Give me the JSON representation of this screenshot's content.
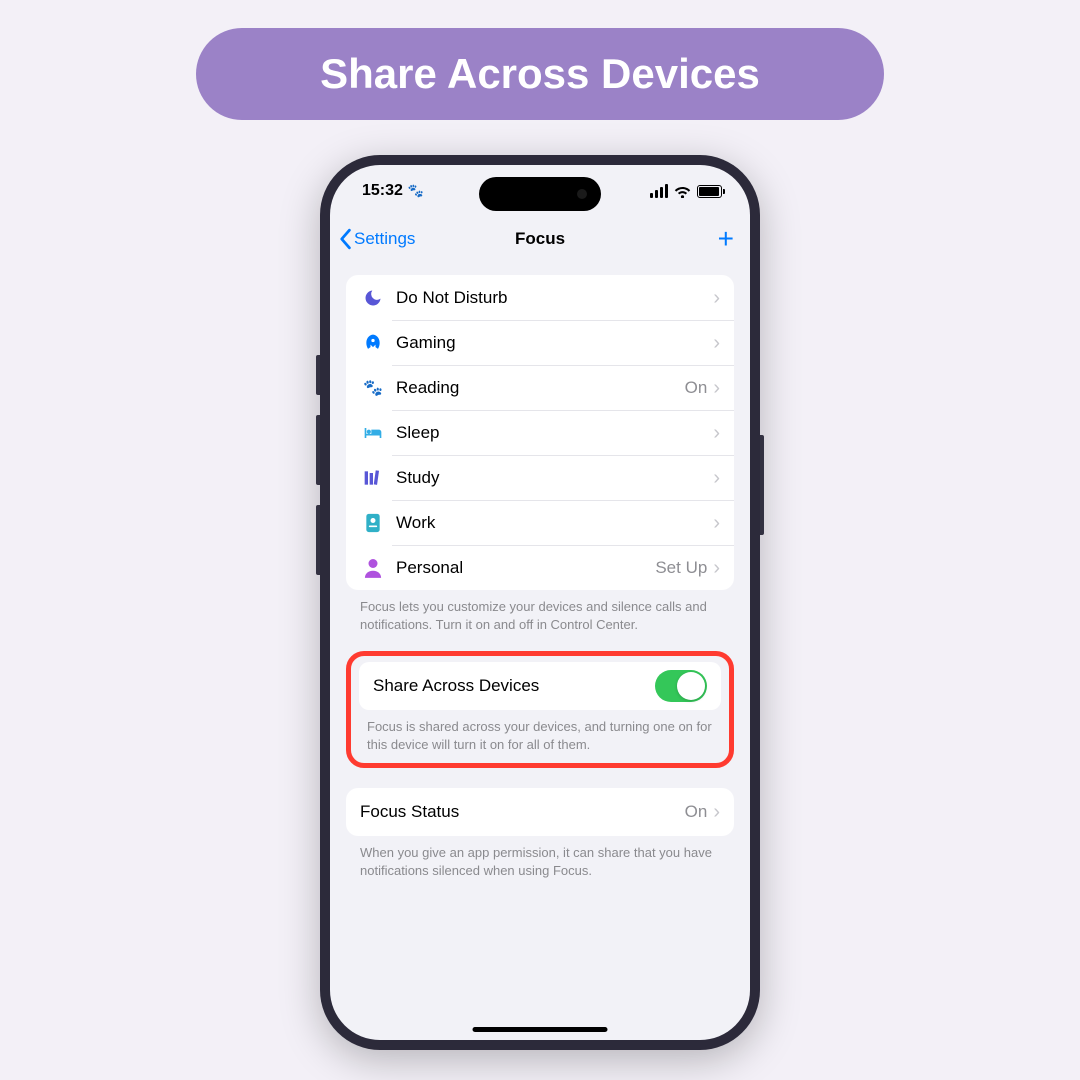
{
  "banner": {
    "title": "Share Across Devices"
  },
  "statusBar": {
    "time": "15:32",
    "paw": "🐾"
  },
  "nav": {
    "back": "Settings",
    "title": "Focus"
  },
  "focusList": [
    {
      "label": "Do Not Disturb",
      "value": ""
    },
    {
      "label": "Gaming",
      "value": ""
    },
    {
      "label": "Reading",
      "value": "On"
    },
    {
      "label": "Sleep",
      "value": ""
    },
    {
      "label": "Study",
      "value": ""
    },
    {
      "label": "Work",
      "value": ""
    },
    {
      "label": "Personal",
      "value": "Set Up"
    }
  ],
  "focusFooter": "Focus lets you customize your devices and silence calls and notifications. Turn it on and off in Control Center.",
  "share": {
    "label": "Share Across Devices",
    "enabled": true,
    "footer": "Focus is shared across your devices, and turning one on for this device will turn it on for all of them."
  },
  "focusStatus": {
    "label": "Focus Status",
    "value": "On",
    "footer": "When you give an app permission, it can share that you have notifications silenced when using Focus."
  },
  "colors": {
    "accentBlue": "#007aff",
    "toggleGreen": "#34c759",
    "highlightRed": "#ff3b30",
    "bannerPurple": "#9b82c7"
  }
}
